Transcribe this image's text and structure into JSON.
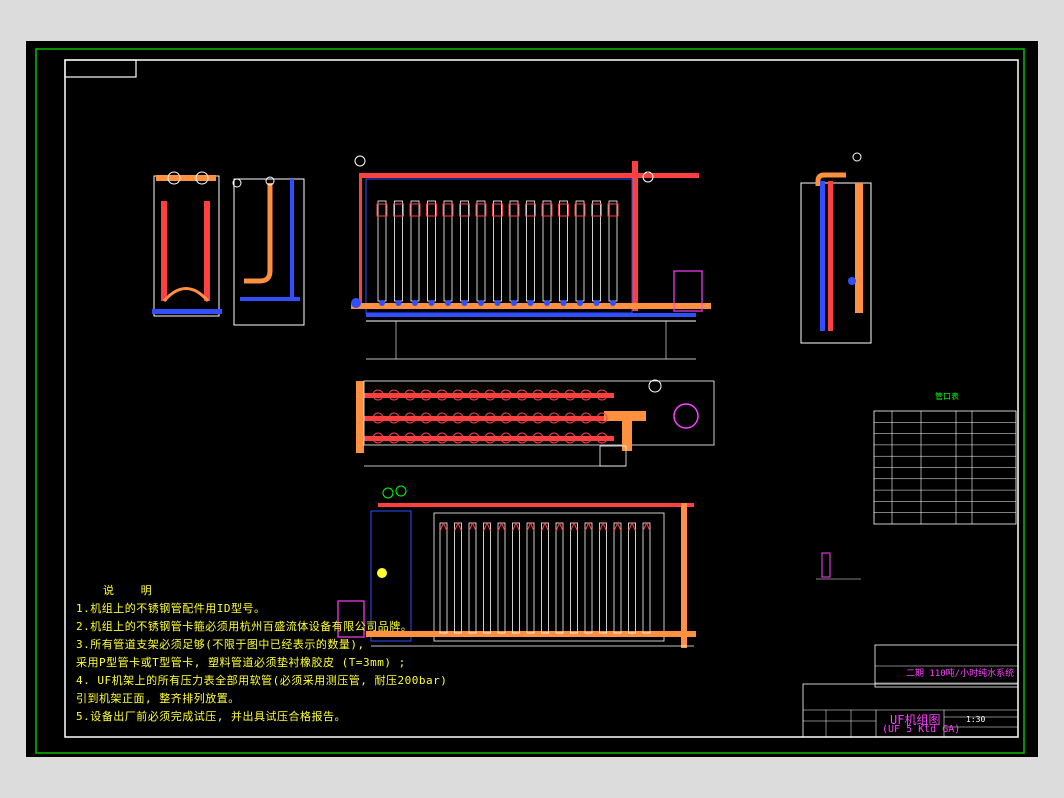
{
  "notes": {
    "title": "说  明",
    "lines": [
      "1.机组上的不锈钢管配件用ID型号。",
      "2.机组上的不锈钢管卡箍必须用杭州百盛流体设备有限公司品牌。",
      "3.所有管道支架必须足够(不限于图中已经表示的数量),",
      "  采用P型管卡或T型管卡, 塑料管道必须垫衬橡胶皮 (T=3mm) ;",
      "4. UF机架上的所有压力表全部用软管(必须采用测压管, 耐压200bar)",
      "  引到机架正面, 整齐排列放置。",
      "5.设备出厂前必须完成试压, 并出具试压合格报告。"
    ]
  },
  "title_block": {
    "project": "二期 110吨/小时纯水系统",
    "drawing_name": "UF机组图",
    "drawing_name_en": "(UF 5 Ktd GA)",
    "scale": "1:30"
  },
  "parts_table": {
    "title": "管口表"
  },
  "colors": {
    "background": "#000000",
    "frame": "#00cc00",
    "pipe_main": "#ff3030",
    "module": "#ffffff",
    "note_text": "#ffff30",
    "title_text": "#ff40ff"
  }
}
